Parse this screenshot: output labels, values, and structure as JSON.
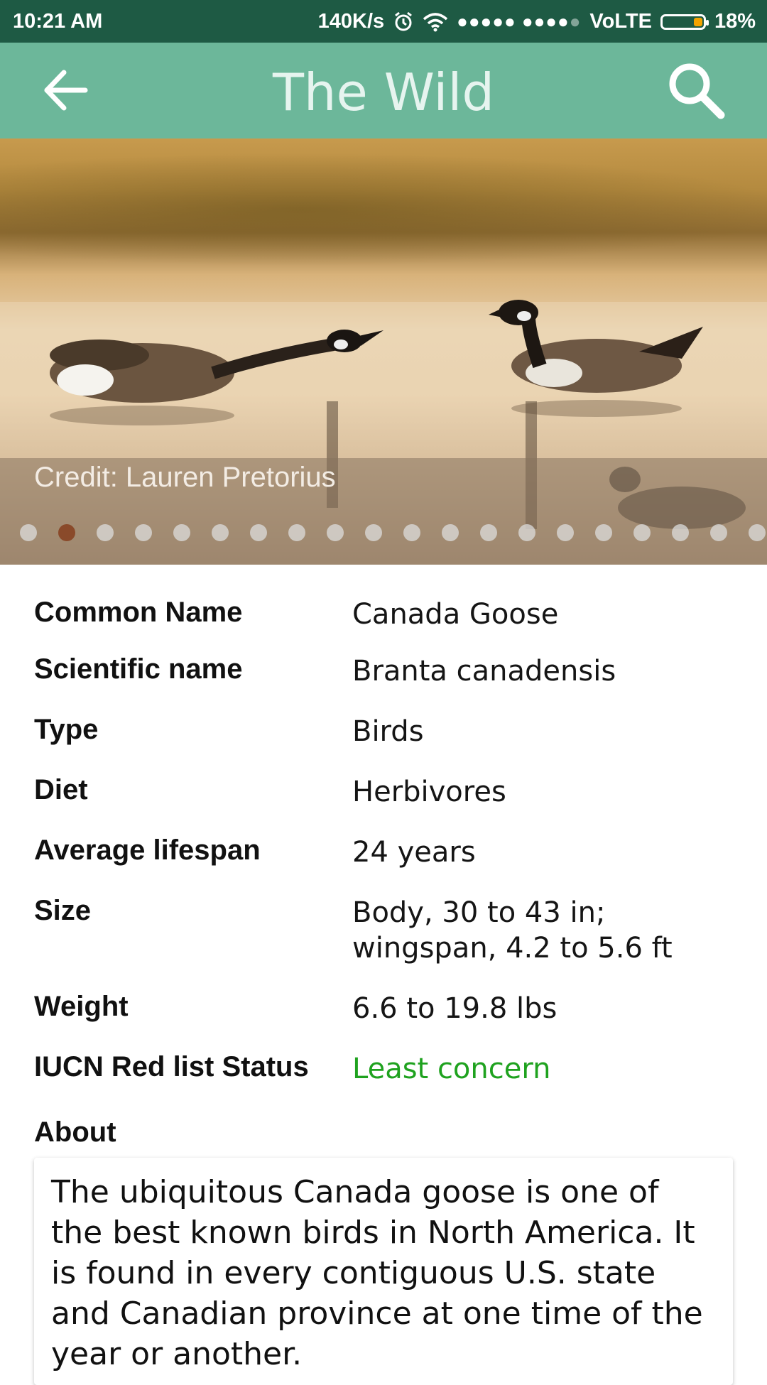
{
  "status_bar": {
    "time": "10:21 AM",
    "speed": "140K/s",
    "icons": [
      "alarm-icon",
      "wifi-icon",
      "signal-icon"
    ],
    "network": "VoLTE",
    "battery": "18%"
  },
  "appbar": {
    "title": "The Wild",
    "back_icon": "arrow-left-icon",
    "search_icon": "search-icon",
    "color": "#6cb79a"
  },
  "hero": {
    "credit": "Credit: Lauren Pretorius",
    "image_count": 20,
    "active_index": 1
  },
  "info": [
    {
      "label": "Common Name",
      "value": "Canada Goose"
    },
    {
      "label": "Scientific name",
      "value": "Branta canadensis"
    },
    {
      "label": "Type",
      "value": "Birds"
    },
    {
      "label": "Diet",
      "value": "Herbivores"
    },
    {
      "label": "Average lifespan",
      "value": "24 years"
    },
    {
      "label": "Size",
      "value": "Body, 30 to 43 in; wingspan, 4.2 to 5.6 ft"
    },
    {
      "label": "Weight",
      "value": "6.6 to 19.8 lbs"
    },
    {
      "label": "IUCN Red list Status",
      "value": "Least concern"
    }
  ],
  "status_color": "#1fa21f",
  "about": {
    "label": "About",
    "text": "The ubiquitous Canada goose is one of the best known birds in North America. It is found in every contiguous U.S. state and Canadian province at one time of the year or another."
  }
}
